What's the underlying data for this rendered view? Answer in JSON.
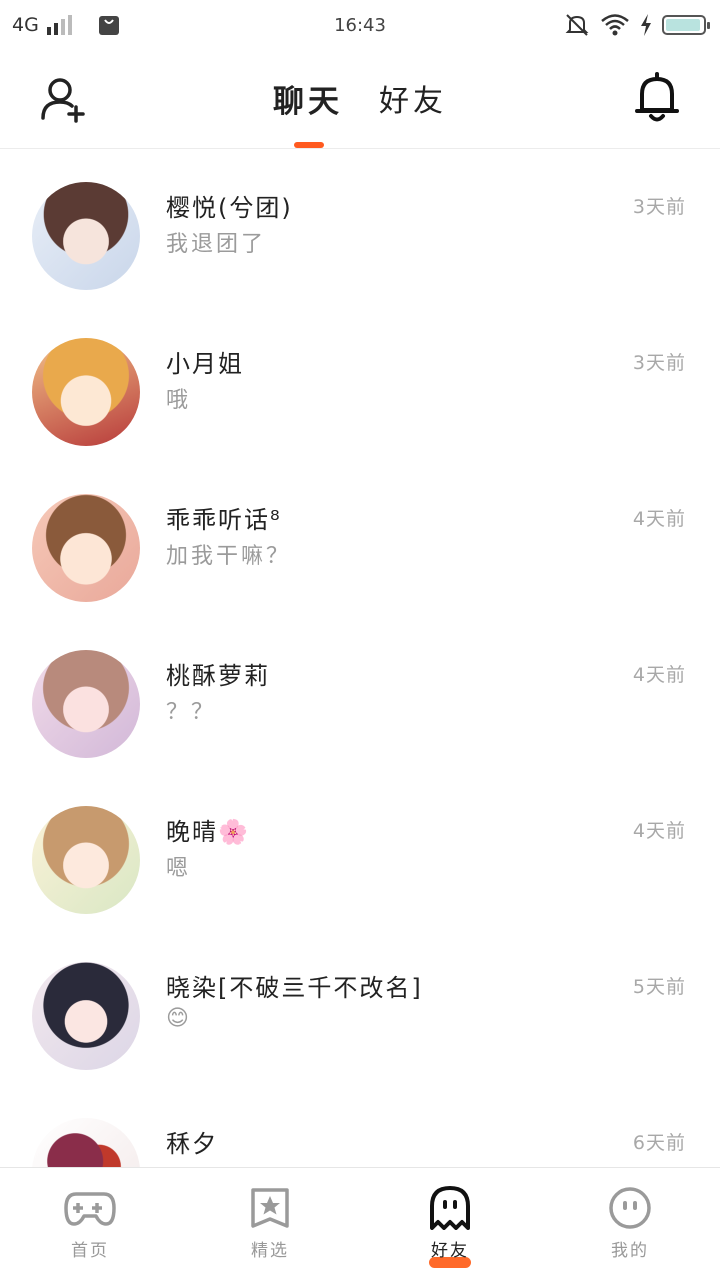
{
  "status_bar": {
    "network": "4G",
    "time": "16:43",
    "battery_level": 0.95
  },
  "header": {
    "tabs": [
      {
        "label": "聊天",
        "active": true
      },
      {
        "label": "好友",
        "active": false
      }
    ],
    "add_friend_icon": "add-user-icon",
    "bell_icon": "bell-icon"
  },
  "chats": [
    {
      "name": "樱悦(兮团)",
      "message": "我退团了",
      "time": "3天前"
    },
    {
      "name": "小月姐",
      "message": "哦",
      "time": "3天前"
    },
    {
      "name": "乖乖听话⁸",
      "message": "加我干嘛？",
      "time": "4天前"
    },
    {
      "name": "桃酥萝莉",
      "message": "？？",
      "time": "4天前"
    },
    {
      "name": "晚晴🌸",
      "message": "嗯",
      "time": "4天前"
    },
    {
      "name": "晓染[不破亖千不改名]",
      "message": "😊",
      "time": "5天前"
    },
    {
      "name": "秝夕",
      "message": "",
      "time": "6天前"
    }
  ],
  "bottom_nav": [
    {
      "label": "首页",
      "icon": "gamepad-icon",
      "active": false
    },
    {
      "label": "精选",
      "icon": "star-icon",
      "active": false
    },
    {
      "label": "好友",
      "icon": "ghost-icon",
      "active": true
    },
    {
      "label": "我的",
      "icon": "face-icon",
      "active": false
    }
  ],
  "colors": {
    "accent": "#ff5a1f",
    "muted_text": "#9b9b9b",
    "time_text": "#a8a8a8"
  }
}
